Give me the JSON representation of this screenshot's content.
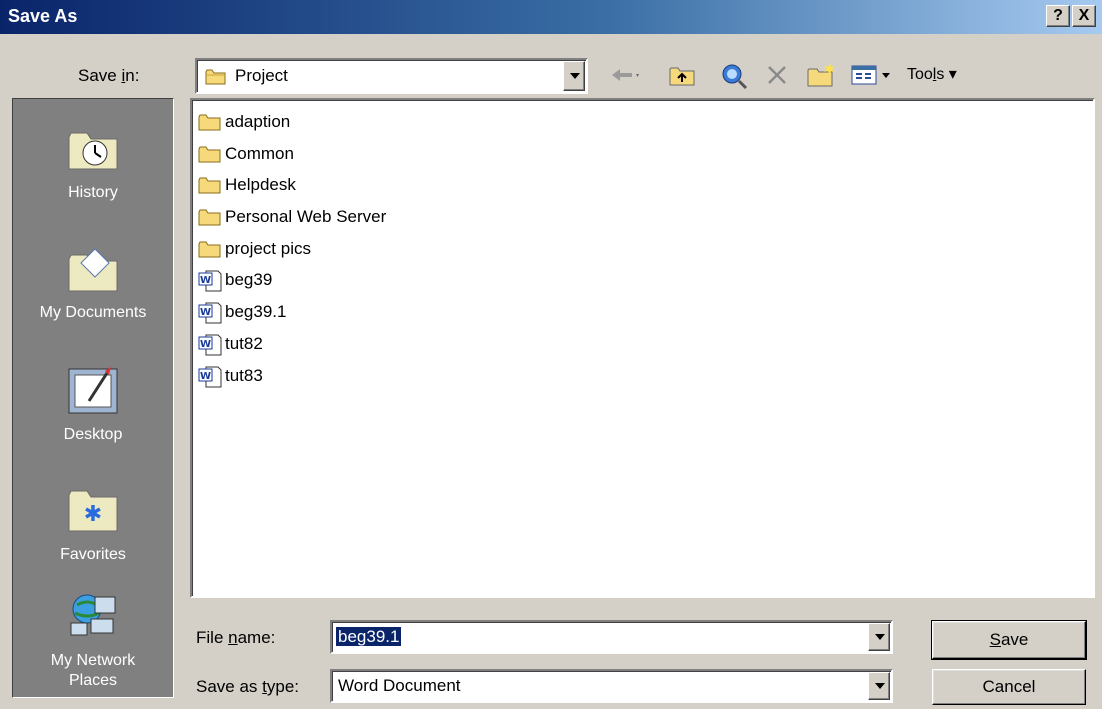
{
  "window": {
    "title": "Save As",
    "help_glyph": "?",
    "close_glyph": "X"
  },
  "save_in": {
    "label_pre": "Save ",
    "label_key": "i",
    "label_post": "n:",
    "value": "Project"
  },
  "toolbar": {
    "tools_pre": "Too",
    "tools_key": "l",
    "tools_post": "s"
  },
  "places": [
    {
      "label": "History",
      "icon": "history-icon"
    },
    {
      "label": "My Documents",
      "icon": "my-documents-icon"
    },
    {
      "label": "Desktop",
      "icon": "desktop-icon"
    },
    {
      "label": "Favorites",
      "icon": "favorites-icon"
    },
    {
      "label_line1": "My Network",
      "label_line2": "Places",
      "icon": "network-places-icon"
    }
  ],
  "files": [
    {
      "name": "adaption",
      "type": "folder"
    },
    {
      "name": "Common",
      "type": "folder"
    },
    {
      "name": "Helpdesk",
      "type": "folder"
    },
    {
      "name": "Personal Web Server",
      "type": "folder"
    },
    {
      "name": "project pics",
      "type": "folder"
    },
    {
      "name": "beg39",
      "type": "word"
    },
    {
      "name": "beg39.1",
      "type": "word"
    },
    {
      "name": "tut82",
      "type": "word"
    },
    {
      "name": "tut83",
      "type": "word"
    }
  ],
  "file_name": {
    "label_pre": "File ",
    "label_key": "n",
    "label_post": "ame:",
    "value": "beg39.1"
  },
  "save_as_type": {
    "label_pre": "Save as ",
    "label_key": "t",
    "label_post": "ype:",
    "value": "Word Document"
  },
  "buttons": {
    "save_key": "S",
    "save_post": "ave",
    "cancel": "Cancel"
  },
  "colors": {
    "title_start": "#0a246a",
    "title_end": "#a6caf0",
    "face": "#d4d0c8",
    "places_bg": "#808080",
    "selection": "#0a246a"
  }
}
